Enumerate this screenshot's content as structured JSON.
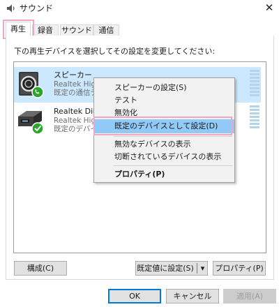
{
  "window": {
    "title": "サウンド",
    "close_glyph": "✕"
  },
  "tabs": [
    {
      "label": "再生",
      "active": true
    },
    {
      "label": "録音"
    },
    {
      "label": "サウンド"
    },
    {
      "label": "通信"
    }
  ],
  "instruction": "下の再生デバイスを選択してその設定を変更してください:",
  "devices": [
    {
      "name": "スピーカー",
      "line1": "Realtek High",
      "line2": "既定の通信デ",
      "status": "communications-default",
      "selected": true
    },
    {
      "name": "Realtek Digit",
      "line1": "Realtek High",
      "line2": "既定のデバイ",
      "status": "default"
    }
  ],
  "context_menu": {
    "items": [
      {
        "label": "スピーカーの設定(S)"
      },
      {
        "label": "テスト"
      },
      {
        "label": "無効化"
      },
      {
        "label": "既定のデバイスとして設定(D)",
        "hover": true
      },
      {
        "label": "無効なデバイスの表示"
      },
      {
        "label": "切断されているデバイスの表示"
      },
      {
        "label": "プロパティ(P)",
        "bold": true
      }
    ]
  },
  "buttons": {
    "configure": "構成(C)",
    "set_default": "既定値に設定(S)",
    "dropdown_glyph": "▾",
    "properties": "プロパティ(P)",
    "ok": "OK",
    "cancel": "キャンセル",
    "apply": "適用(A)"
  },
  "colors": {
    "accent": "#0078d7",
    "selection": "#cce8ff",
    "menu_hover": "#91c9f7",
    "annotation_highlight": "#f1a5c7",
    "status_green": "#2ba52b"
  }
}
